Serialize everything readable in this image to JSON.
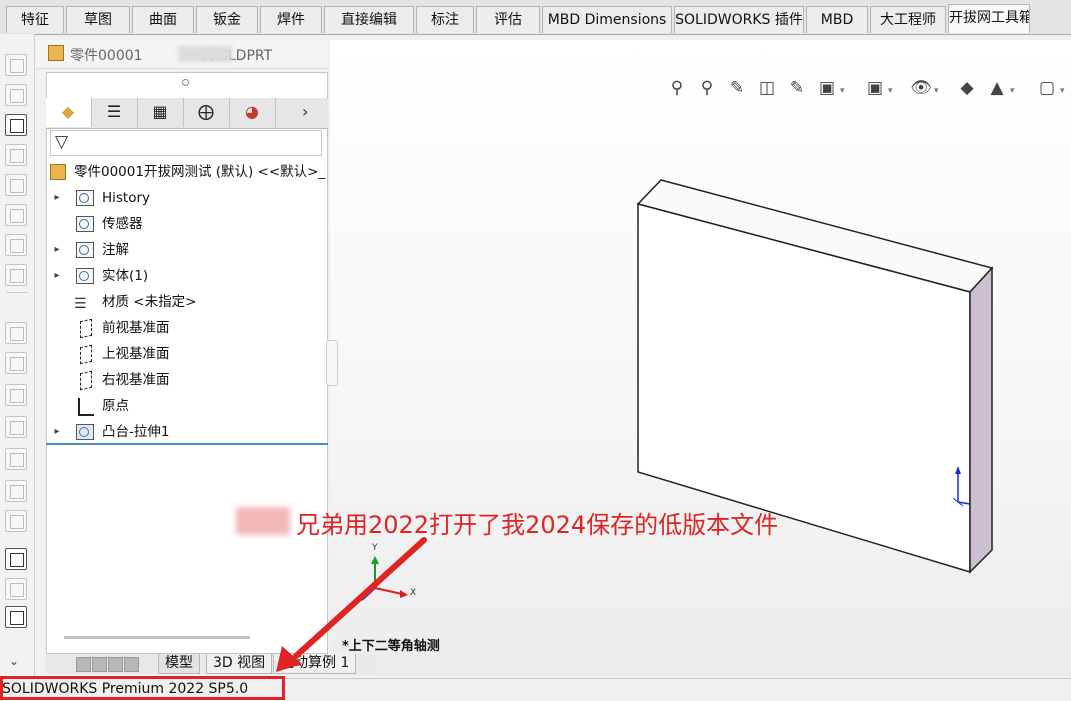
{
  "tabs": [
    "特征",
    "草图",
    "曲面",
    "钣金",
    "焊件",
    "直接编辑",
    "标注",
    "评估",
    "MBD Dimensions",
    "SOLIDWORKS 插件",
    "MBD",
    "大工程师",
    "开拔网工具箱"
  ],
  "active_tab": "开拔网工具箱",
  "document": {
    "title_prefix": "零件00001",
    "title_suffix": "试.SLDPRT"
  },
  "feature_tree": {
    "root": "零件00001开拔网测试 (默认) <<默认>_",
    "items": [
      {
        "label": "History",
        "icon": "history-folder-icon",
        "expandable": true
      },
      {
        "label": "传感器",
        "icon": "sensor-folder-icon",
        "expandable": false
      },
      {
        "label": "注解",
        "icon": "annotation-folder-icon",
        "expandable": true
      },
      {
        "label": "实体(1)",
        "icon": "solid-bodies-icon",
        "expandable": true
      },
      {
        "label": "材质 <未指定>",
        "icon": "material-icon",
        "expandable": false
      },
      {
        "label": "前视基准面",
        "icon": "plane-icon",
        "expandable": false
      },
      {
        "label": "上视基准面",
        "icon": "plane-icon",
        "expandable": false
      },
      {
        "label": "右视基准面",
        "icon": "plane-icon",
        "expandable": false
      },
      {
        "label": "原点",
        "icon": "origin-icon",
        "expandable": false
      },
      {
        "label": "凸台-拉伸1",
        "icon": "extrude-feature-icon",
        "expandable": true
      }
    ]
  },
  "bottom_tabs": [
    "模型",
    "3D 视图",
    "运动算例 1"
  ],
  "status_text": "SOLIDWORKS Premium 2022 SP5.0",
  "view": {
    "orientation_label": "*上下二等角轴测",
    "triad": {
      "x": "X",
      "y": "Y"
    }
  },
  "annotation": {
    "text": "兄弟用2022打开了我2024保存的低版本文件",
    "color": "#e02424"
  },
  "colors": {
    "accent": "#4a8ab8",
    "annotation": "#e02424"
  }
}
